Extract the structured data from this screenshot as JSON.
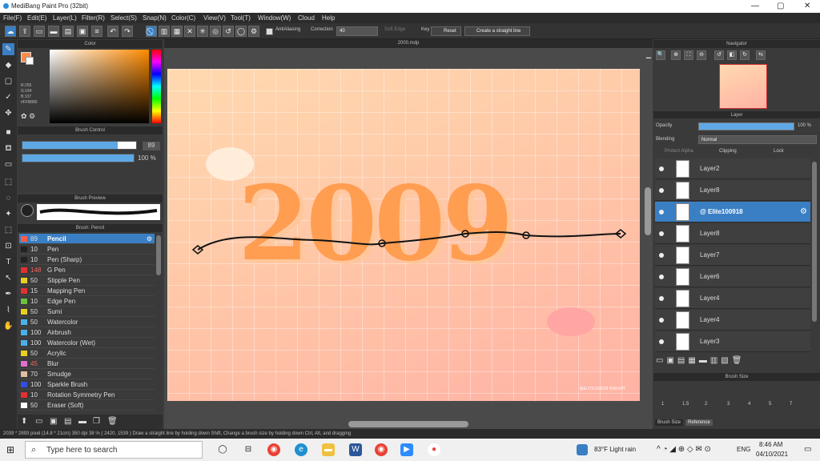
{
  "app": {
    "title": "MediBang Paint Pro (32bit)"
  },
  "menu": [
    "File(F)",
    "Edit(E)",
    "Layer(L)",
    "Filter(R)",
    "Select(S)",
    "Snap(N)",
    "Color(C)",
    "View(V)",
    "Tool(T)",
    "Window(W)",
    "Cloud",
    "Help"
  ],
  "toolbar": {
    "antialias_label": "AntiAliasing",
    "correction_label": "Correction",
    "correction_value": "40",
    "soft_edge_label": "Soft Edge",
    "key_label": "Key",
    "reset_label": "Reset",
    "straight_line_label": "Create a straight line"
  },
  "document": {
    "tab": "2000.mdp"
  },
  "color_panel": {
    "title": "Color",
    "r": "R:255",
    "g": "G:184",
    "b": "B:137",
    "hex": "#FFB889"
  },
  "brush_control": {
    "title": "Brush Control",
    "size": "89",
    "opacity": "100 %"
  },
  "brush_preview": {
    "title": "Brush Preview"
  },
  "brush_list": {
    "title": "Brush: Pencil",
    "items": [
      {
        "size": "89",
        "name": "Pencil",
        "color": "#ff5a4a"
      },
      {
        "size": "10",
        "name": "Pen",
        "color": "#222222"
      },
      {
        "size": "10",
        "name": "Pen (Sharp)",
        "color": "#222222"
      },
      {
        "size": "148",
        "name": "G Pen",
        "color": "#e03030"
      },
      {
        "size": "50",
        "name": "Stipple Pen",
        "color": "#e8d020"
      },
      {
        "size": "15",
        "name": "Mapping Pen",
        "color": "#e03030"
      },
      {
        "size": "10",
        "name": "Edge Pen",
        "color": "#6ac040"
      },
      {
        "size": "50",
        "name": "Sumi",
        "color": "#e8d020"
      },
      {
        "size": "50",
        "name": "Watercolor",
        "color": "#4ab0e8"
      },
      {
        "size": "100",
        "name": "Airbrush",
        "color": "#4ab0e8"
      },
      {
        "size": "100",
        "name": "Watercolor (Wet)",
        "color": "#4ab0e8"
      },
      {
        "size": "50",
        "name": "Acrylic",
        "color": "#e8d020"
      },
      {
        "size": "45",
        "name": "Blur",
        "color": "#e070d0"
      },
      {
        "size": "70",
        "name": "Smudge",
        "color": "#e0c0a0"
      },
      {
        "size": "100",
        "name": "Sparkle Brush",
        "color": "#3050e0"
      },
      {
        "size": "10",
        "name": "Rotation Symmetry Pen",
        "color": "#e03030"
      },
      {
        "size": "50",
        "name": "Eraser (Soft)",
        "color": "#ffffff"
      }
    ]
  },
  "canvas": {
    "art_text": "2009",
    "signature": "@ELITE100918 INSIGHT"
  },
  "navigator": {
    "title": "Navigator"
  },
  "layer_panel": {
    "title": "Layer",
    "opacity_label": "Opacity",
    "opacity_value": "100 %",
    "blending_label": "Blending",
    "blending_value": "Normal",
    "protect_alpha": "Protect Alpha",
    "clipping": "Clipping",
    "lock": "Lock",
    "layers": [
      "Layer2",
      "Layer8",
      "@ Elite100918",
      "Layer8",
      "Layer7",
      "Layer6",
      "Layer4",
      "Layer4",
      "Layer3"
    ]
  },
  "brush_size_panel": {
    "title": "Brush Size",
    "sizes": [
      "1",
      "1.5",
      "2",
      "3",
      "4",
      "5",
      "7"
    ],
    "tab1": "Brush Size",
    "tab2": "Reference"
  },
  "status": "2039 * 2893 pixel  (14.8 * 21cm)  350 dpi  38 %  ( 2420, 1539 )  Draw a straight line by holding down Shift, Change a brush size by holding down Ctrl, Alt, and dragging",
  "taskbar": {
    "search_placeholder": "Type here to search",
    "weather": "83°F  Light rain",
    "lang": "ENG",
    "time": "8:46 AM",
    "date": "04/10/2021"
  }
}
